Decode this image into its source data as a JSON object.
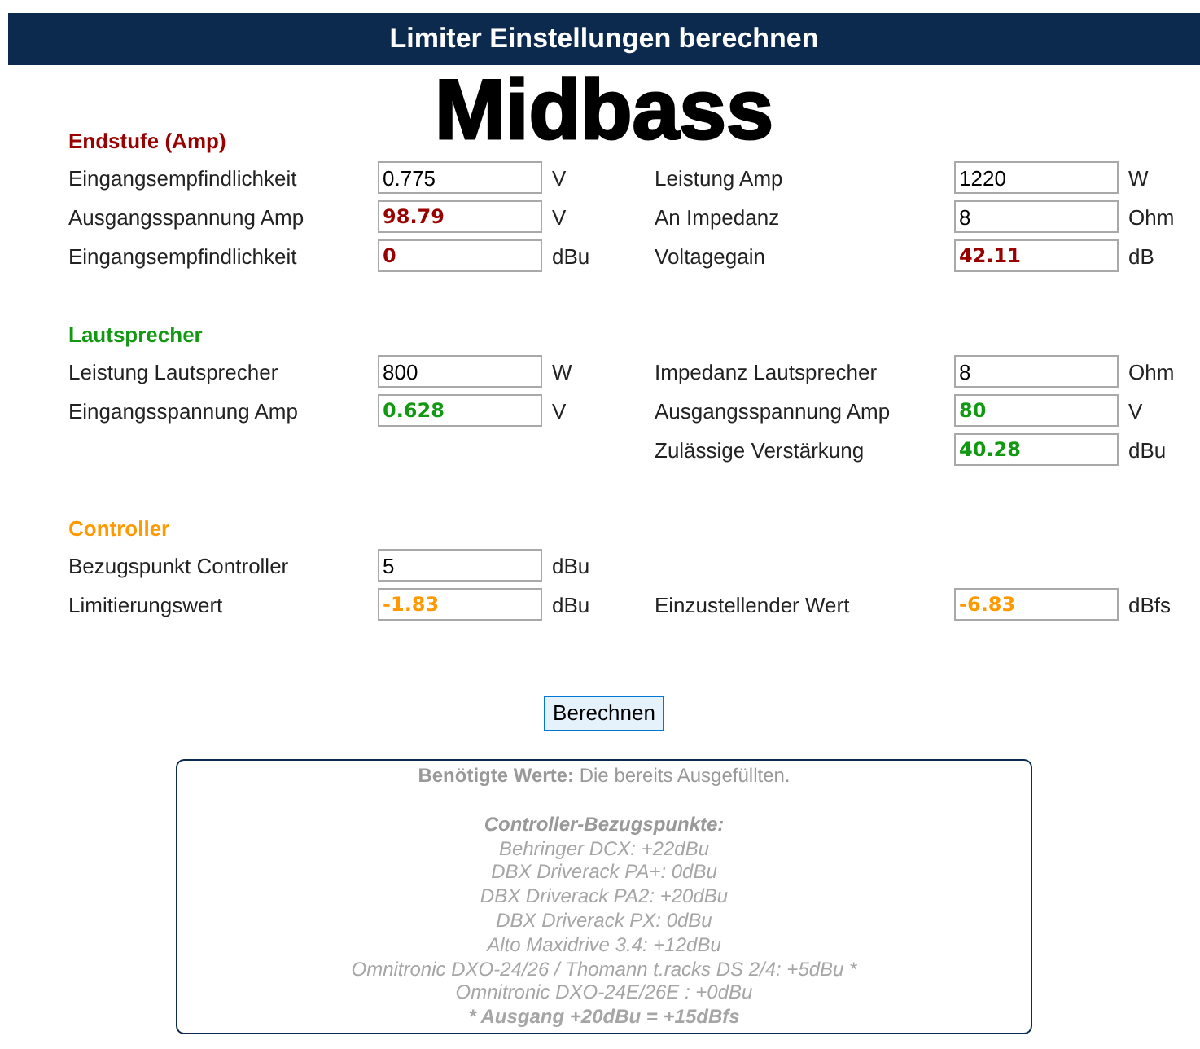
{
  "header": {
    "title": "Limiter Einstellungen berechnen"
  },
  "heading": "Midbass",
  "sections": [
    {
      "title": "Endstufe (Amp)",
      "color": "#990000",
      "rows": [
        {
          "left": {
            "label": "Eingangsempfindlichkeit",
            "value": "0.775",
            "unit": "V",
            "computed": false
          },
          "right": {
            "label": "Leistung Amp",
            "value": "1220",
            "unit": "W",
            "computed": false
          }
        },
        {
          "left": {
            "label": "Ausgangsspannung Amp",
            "value": "98.79",
            "unit": "V",
            "computed": true
          },
          "right": {
            "label": "An Impedanz",
            "value": "8",
            "unit": "Ohm",
            "computed": false
          }
        },
        {
          "left": {
            "label": "Eingangsempfindlichkeit",
            "value": "0",
            "unit": "dBu",
            "computed": true
          },
          "right": {
            "label": "Voltagegain",
            "value": "42.11",
            "unit": "dB",
            "computed": true
          }
        }
      ]
    },
    {
      "title": "Lautsprecher",
      "color": "#119911",
      "rows": [
        {
          "left": {
            "label": "Leistung Lautsprecher",
            "value": "800",
            "unit": "W",
            "computed": false
          },
          "right": {
            "label": "Impedanz Lautsprecher",
            "value": "8",
            "unit": "Ohm",
            "computed": false
          }
        },
        {
          "left": {
            "label": "Eingangsspannung Amp",
            "value": "0.628",
            "unit": "V",
            "computed": true
          },
          "right": {
            "label": "Ausgangsspannung Amp",
            "value": "80",
            "unit": "V",
            "computed": true
          }
        },
        {
          "right": {
            "label": "Zulässige Verstärkung",
            "value": "40.28",
            "unit": "dBu",
            "computed": true
          }
        }
      ]
    },
    {
      "title": "Controller",
      "color": "#ff9900",
      "rows": [
        {
          "left": {
            "label": "Bezugspunkt Controller",
            "value": "5",
            "unit": "dBu",
            "computed": false
          }
        },
        {
          "left": {
            "label": "Limitierungswert",
            "value": "-1.83",
            "unit": "dBu",
            "computed": true
          },
          "right": {
            "label": "Einzustellender Wert",
            "value": "-6.83",
            "unit": "dBfs",
            "computed": true
          }
        }
      ]
    }
  ],
  "button": {
    "label": "Berechnen"
  },
  "info": {
    "lines": [
      {
        "kind": "intro",
        "text": "**Benötigte Werte:** Die bereits Ausgefüllten."
      },
      {
        "kind": "heading",
        "text": "Controller-Bezugspunkte:"
      },
      {
        "kind": "item",
        "text": "Behringer DCX: +22dBu"
      },
      {
        "kind": "item",
        "text": "DBX Driverack PA+: 0dBu"
      },
      {
        "kind": "item",
        "text": "DBX Driverack PA2: +20dBu"
      },
      {
        "kind": "item",
        "text": "DBX Driverack PX: 0dBu"
      },
      {
        "kind": "item",
        "text": "Alto Maxidrive 3.4: +12dBu"
      },
      {
        "kind": "item",
        "text": "Omnitronic DXO-24/26 / Thomann t.racks DS 2/4: +5dBu *"
      },
      {
        "kind": "item",
        "text": "Omnitronic DXO-24E/26E : +0dBu"
      },
      {
        "kind": "footnote",
        "text": "* Ausgang +20dBu = +15dBfs"
      }
    ]
  }
}
